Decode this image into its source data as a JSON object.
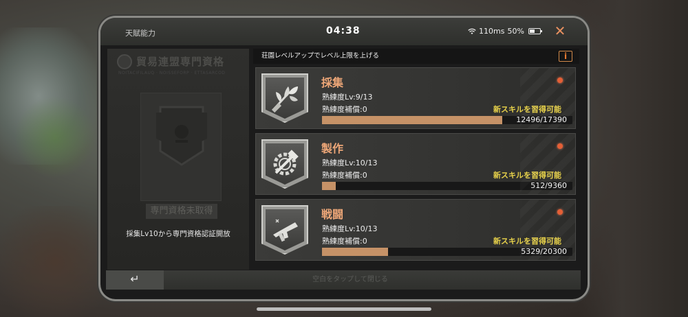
{
  "status_bar": {
    "title": "天賦能力",
    "time": "04:38",
    "network": "110ms",
    "battery": "50%",
    "battery_level": 0.5
  },
  "left_panel": {
    "guild_title": "貿易連盟専門資格",
    "guild_subtitle": "NOITACIFILAUQ · NOISSEFORP · ETTASARCOD",
    "badge_status": "専門資格未取得",
    "unlock_note": "採集Lv10から専門資格認証開放"
  },
  "notice": {
    "text": "荘園レベルアップでレベル上限を上げる",
    "info_label": "i"
  },
  "skills": [
    {
      "name": "採集",
      "level": "熟練度Lv:9/13",
      "compensation": "熟練度補償:0",
      "new_skill": "新スキルを習得可能",
      "progress_text": "12496/17390",
      "progress": 0.7186,
      "icon": "leaf-branch-icon"
    },
    {
      "name": "製作",
      "level": "熟練度Lv:10/13",
      "compensation": "熟練度補償:0",
      "new_skill": "新スキルを習得可能",
      "progress_text": "512/9360",
      "progress": 0.0547,
      "icon": "gear-hammer-icon"
    },
    {
      "name": "戦闘",
      "level": "熟練度Lv:10/13",
      "compensation": "熟練度補償:0",
      "new_skill": "新スキルを習得可能",
      "progress_text": "5329/20300",
      "progress": 0.2625,
      "icon": "submachine-gun-icon"
    }
  ],
  "bottom": {
    "back_icon": "↵",
    "close_hint": "空白をタップして閉じる"
  },
  "colors": {
    "accent": "#eea778",
    "progress": "#c69267",
    "new_skill": "#e8d24a",
    "dot": "#e35a30"
  }
}
